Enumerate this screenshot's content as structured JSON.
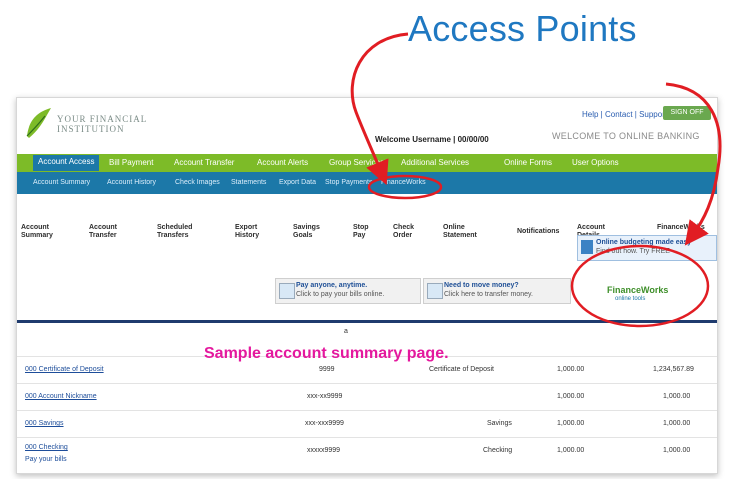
{
  "callout": {
    "title": "Access Points",
    "caption": "Sample account summary page.",
    "color": "#e11d23"
  },
  "header": {
    "logo_line1": "YOUR FINANCIAL",
    "logo_line2": "INSTITUTION",
    "top_links": "Help | Contact | Support",
    "signoff": "SIGN OFF",
    "welcome": "Welcome Username | 00/00/00",
    "banner": "WELCOME TO ONLINE BANKING"
  },
  "nav_main": [
    "Account Access",
    "Bill Payment",
    "Account Transfer",
    "Account Alerts",
    "Group Services",
    "Additional Services",
    "Online Forms",
    "User Options"
  ],
  "nav_sub": [
    "Account Summary",
    "Account History",
    "Check Images",
    "Statements",
    "Export Data",
    "Stop Payments",
    "FinanceWorks"
  ],
  "content_tabs": [
    {
      "l1": "Account",
      "l2": "Summary"
    },
    {
      "l1": "Account",
      "l2": "Transfer"
    },
    {
      "l1": "Scheduled",
      "l2": "Transfers"
    },
    {
      "l1": "Export",
      "l2": "History"
    },
    {
      "l1": "Savings",
      "l2": "Goals"
    },
    {
      "l1": "Stop",
      "l2": "Pay"
    },
    {
      "l1": "Check",
      "l2": "Order"
    },
    {
      "l1": "Online",
      "l2": "Statement"
    },
    {
      "l1": "Notifications",
      "l2": ""
    },
    {
      "l1": "Account",
      "l2": "Details"
    },
    {
      "l1": "FinanceWorks",
      "l2": ""
    }
  ],
  "promos": {
    "pay_t1": "Pay anyone, anytime.",
    "pay_t2": "Click to pay your bills online.",
    "move_t1": "Need to move money?",
    "move_t2": "Click here to transfer money.",
    "side_t1": "Online budgeting made easy",
    "side_t2": "Find out how. Try FREE",
    "fm_logo": "FinanceWorks",
    "fm_sub": "online tools"
  },
  "table": {
    "marker": "a",
    "rows": [
      {
        "name": "000 Certificate of Deposit",
        "number": "9999",
        "type": "Certificate of Deposit",
        "balance": "1,000.00",
        "avail": "1,234,567.89",
        "sub": ""
      },
      {
        "name": "000 Account Nickname",
        "number": "xxx-xx9999",
        "type": "",
        "balance": "1,000.00",
        "avail": "1,000.00",
        "sub": ""
      },
      {
        "name": "000 Savings",
        "number": "xxx-xxx9999",
        "type": "Savings",
        "balance": "1,000.00",
        "avail": "1,000.00",
        "sub": ""
      },
      {
        "name": "000 Checking",
        "number": "xxxxx9999",
        "type": "Checking",
        "balance": "1,000.00",
        "avail": "1,000.00",
        "sub": "Pay your bills"
      }
    ]
  }
}
